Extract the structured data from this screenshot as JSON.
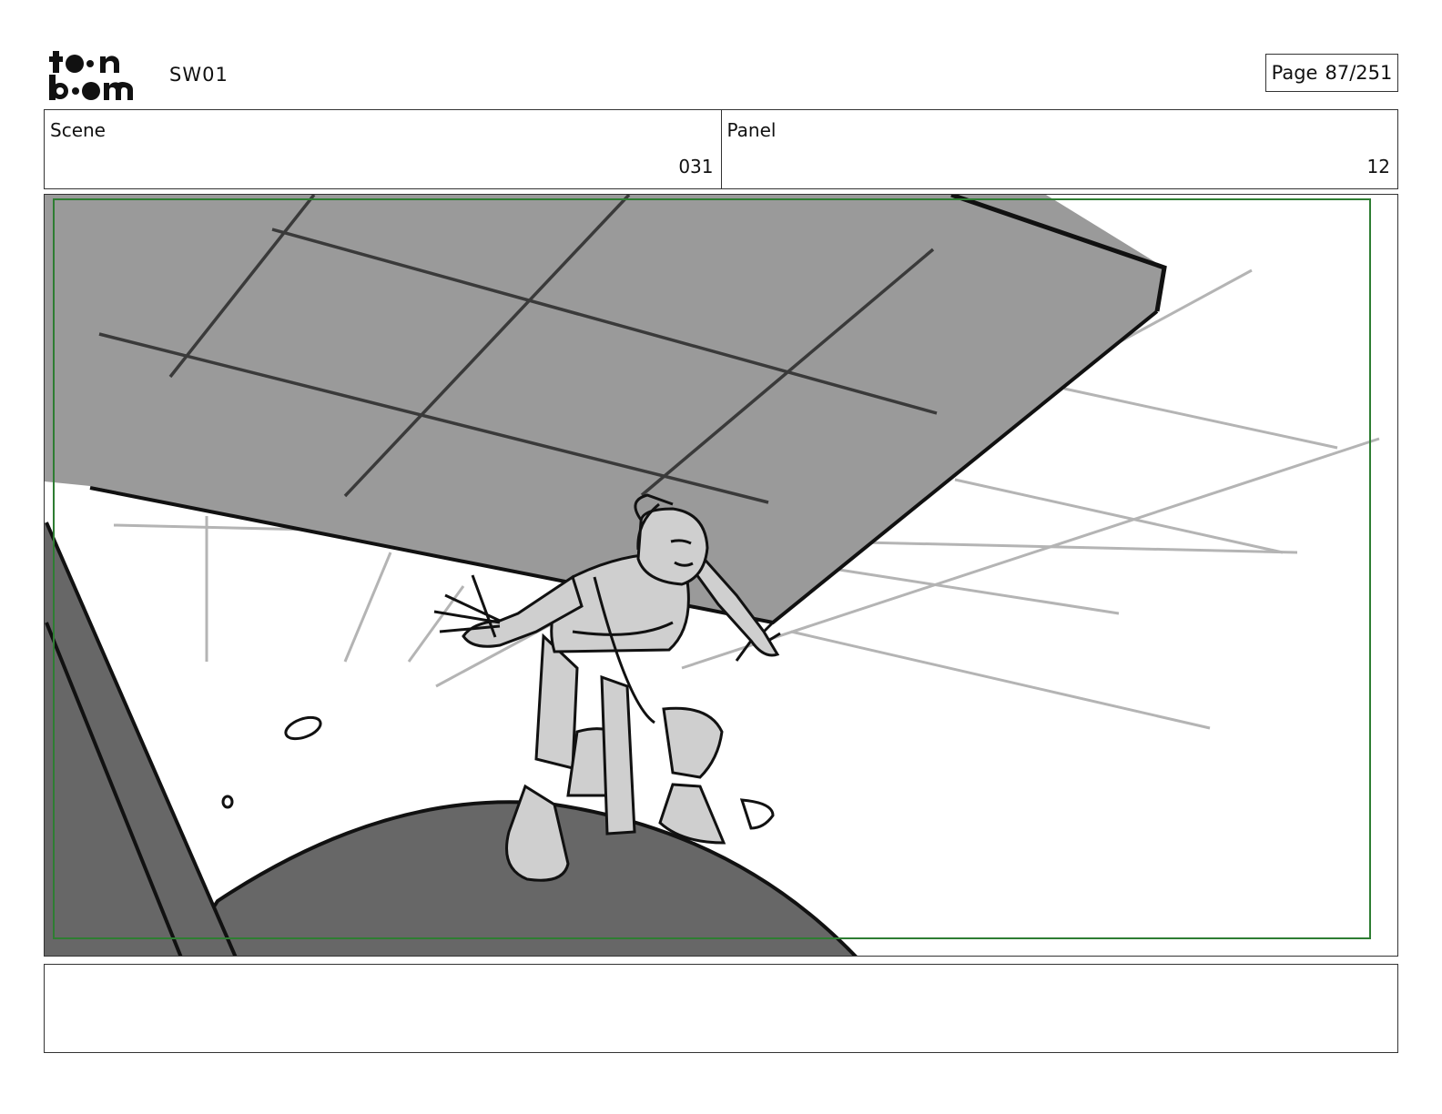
{
  "header": {
    "logo_text": "toon boom",
    "project": "SW01",
    "page_label": "Page",
    "page_number": "87/251"
  },
  "scene": {
    "label": "Scene",
    "value": "031"
  },
  "panel": {
    "label": "Panel",
    "value": "12"
  },
  "notes": {
    "text": ""
  },
  "colors": {
    "safe_frame": "#2e7d32",
    "ceiling_fill": "#9a9a9a",
    "floor_fill": "#676767",
    "character_fill": "#cfcfcf",
    "line": "#111111"
  }
}
